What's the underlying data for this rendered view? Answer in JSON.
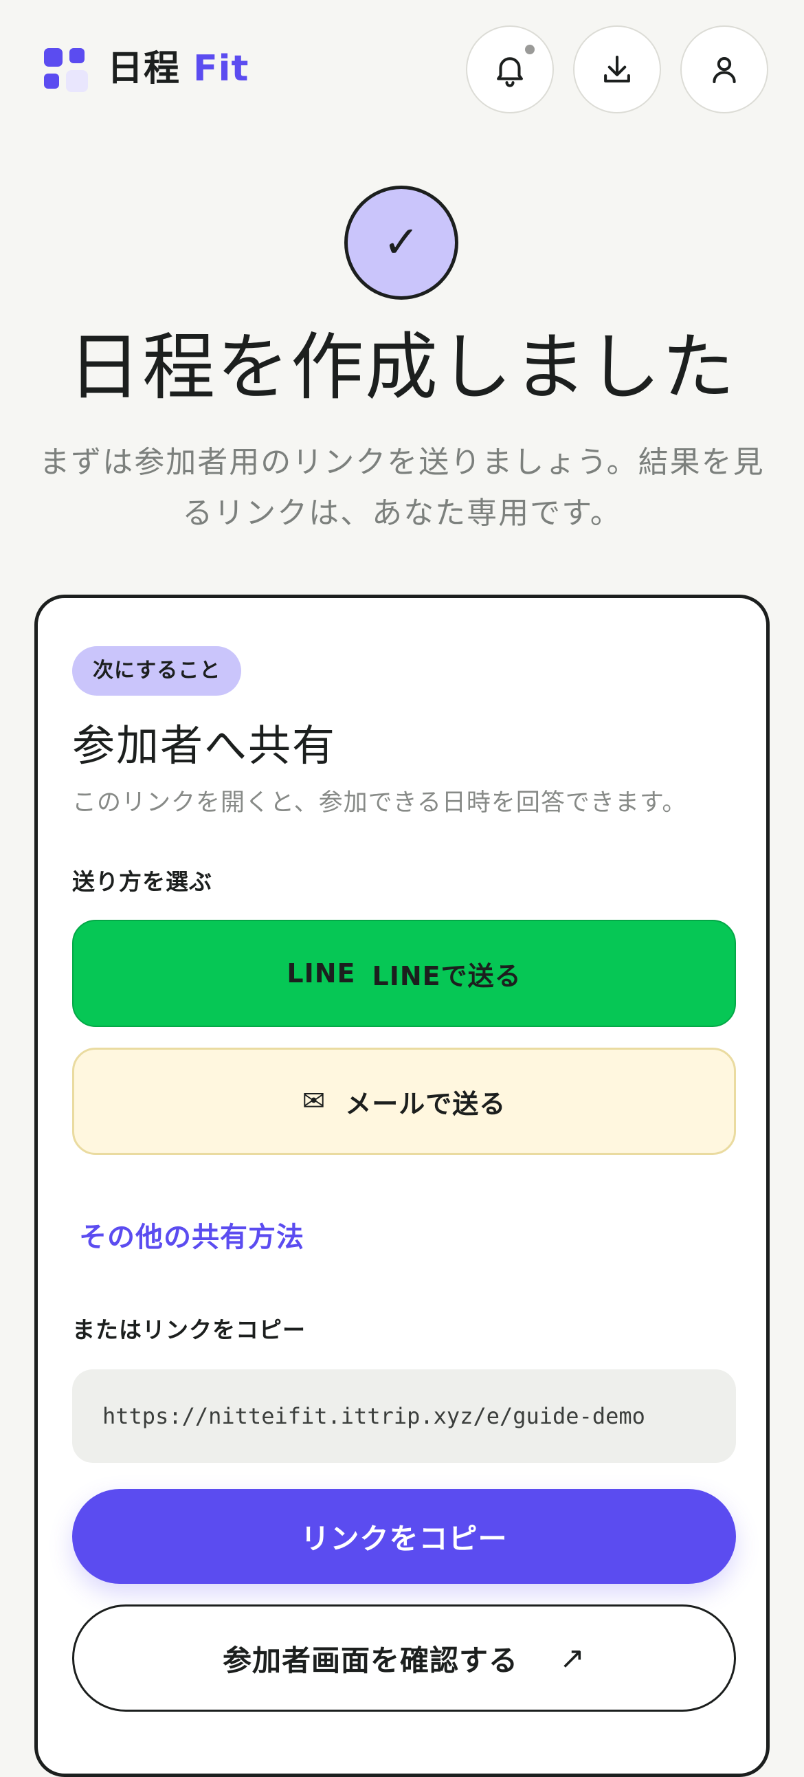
{
  "header": {
    "brand_ja": "日程",
    "brand_en": "Fit",
    "icons": {
      "logo": "app-logo-icon",
      "notifications": "bell-icon",
      "download": "download-icon",
      "account": "user-icon"
    }
  },
  "hero": {
    "check_glyph": "✓",
    "title": "日程を作成しました",
    "subtitle": "まずは参加者用のリンクを送りましょう。結果を見るリンクは、あなた専用です。"
  },
  "card": {
    "badge": "次にすること",
    "title": "参加者へ共有",
    "description": "このリンクを開くと、参加できる日時を回答できます。",
    "send_method_label": "送り方を選ぶ",
    "line_button": {
      "mark": "LINE",
      "label": "LINEで送る"
    },
    "mail_button": {
      "icon": "✉",
      "label": "メールで送る"
    },
    "more_share_link": "その他の共有方法",
    "copy_label": "またはリンクをコピー",
    "url": "https://nitteifit.ittrip.xyz/e/guide-demo",
    "copy_button": "リンクをコピー",
    "view_button": {
      "label": "参加者画面を確認する",
      "arrow": "↗"
    }
  },
  "colors": {
    "accent": "#5b4cf0",
    "accent_light": "#cac5fb",
    "line_green": "#06c755",
    "mail_bg": "#fff7df",
    "background": "#f6f6f3",
    "text": "#1c1f1e"
  }
}
